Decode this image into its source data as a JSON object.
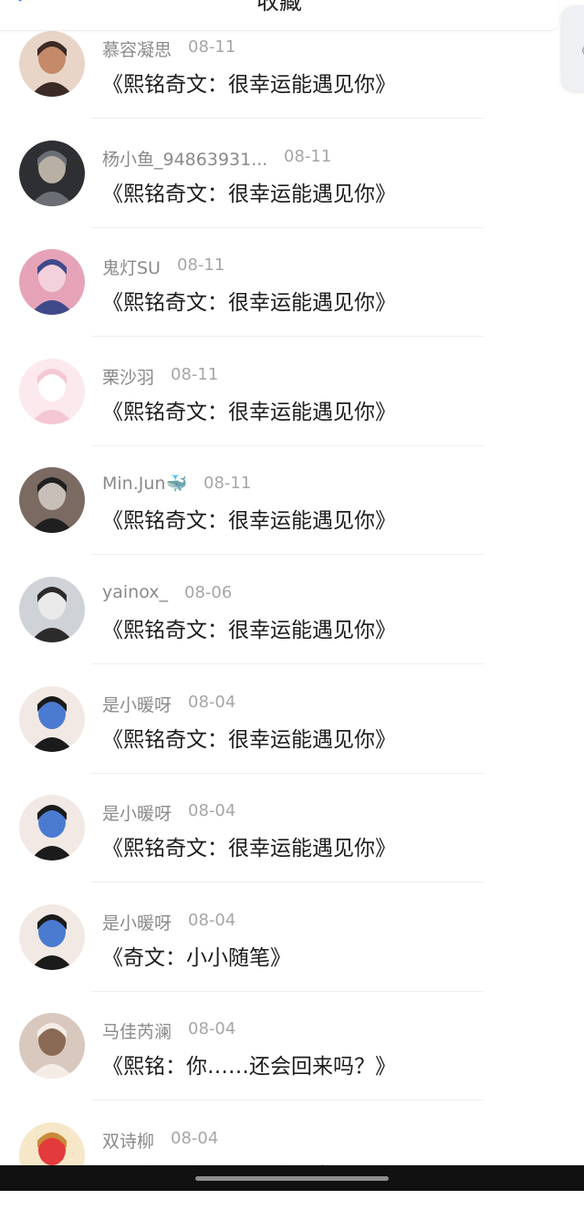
{
  "header": {
    "title": "收藏",
    "back_icon": "chevron-left-icon",
    "accent": "#3a8dff"
  },
  "side_tab": {
    "glyph": "《",
    "icon": "collapse-handle-icon"
  },
  "items": [
    {
      "name": "慕容凝思",
      "date": "08-11",
      "title": "《熙铭奇文：很幸运能遇见你》",
      "avatar_colors": [
        "#e8d5c8",
        "#3b2a25",
        "#c58a6a"
      ]
    },
    {
      "name": "杨小鱼_94863931...",
      "date": "08-11",
      "title": "《熙铭奇文：很幸运能遇见你》",
      "avatar_colors": [
        "#2d2f33",
        "#6b6f75",
        "#b8b0a5"
      ]
    },
    {
      "name": "鬼灯SU",
      "date": "08-11",
      "title": "《熙铭奇文：很幸运能遇见你》",
      "avatar_colors": [
        "#e6a3b8",
        "#3f4a8a",
        "#f2d1dc"
      ]
    },
    {
      "name": "栗沙羽",
      "date": "08-11",
      "title": "《熙铭奇文：很幸运能遇见你》",
      "avatar_colors": [
        "#fbe9ee",
        "#f4c7d3",
        "#ffffff"
      ]
    },
    {
      "name": "Min.Jun🐳",
      "date": "08-11",
      "title": "《熙铭奇文：很幸运能遇见你》",
      "avatar_colors": [
        "#7a6a62",
        "#1f1f1f",
        "#c7bfb8"
      ]
    },
    {
      "name": "yainox_",
      "date": "08-06",
      "title": "《熙铭奇文：很幸运能遇见你》",
      "avatar_colors": [
        "#cfd3d8",
        "#2b2b2b",
        "#eaeaea"
      ]
    },
    {
      "name": "是小暖呀",
      "date": "08-04",
      "title": "《熙铭奇文：很幸运能遇见你》",
      "avatar_colors": [
        "#f3e9e4",
        "#1b1b1b",
        "#4a7bd1"
      ]
    },
    {
      "name": "是小暖呀",
      "date": "08-04",
      "title": "《熙铭奇文：很幸运能遇见你》",
      "avatar_colors": [
        "#f3e9e4",
        "#1b1b1b",
        "#4a7bd1"
      ]
    },
    {
      "name": "是小暖呀",
      "date": "08-04",
      "title": "《奇文：小小随笔》",
      "avatar_colors": [
        "#f3e9e4",
        "#1b1b1b",
        "#4a7bd1"
      ]
    },
    {
      "name": "马佳芮澜",
      "date": "08-04",
      "title": "《熙铭：你……还会回来吗？》",
      "avatar_colors": [
        "#d9c8bd",
        "#f5ece6",
        "#8a6a55"
      ]
    },
    {
      "name": "双诗柳",
      "date": "08-04",
      "title": "《熙铭：你……还会回来吗？》",
      "avatar_colors": [
        "#f6e7c8",
        "#c98a3a",
        "#e33b3b"
      ]
    }
  ]
}
